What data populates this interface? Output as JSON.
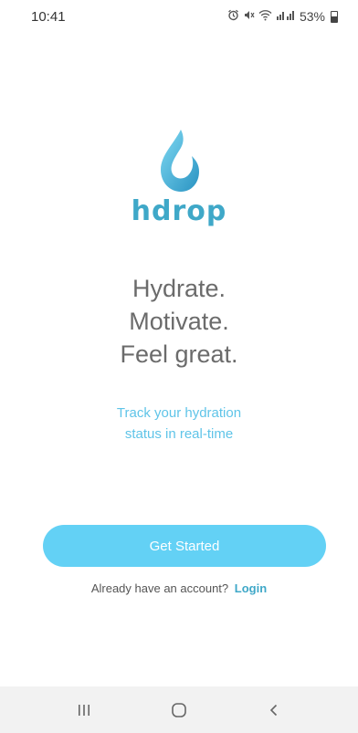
{
  "status_bar": {
    "time": "10:41",
    "battery_percent": "53%",
    "icons": [
      "alarm-icon",
      "mute-icon",
      "wifi-icon",
      "signal-icon",
      "battery-icon"
    ]
  },
  "brand": {
    "name": "hdrop",
    "colors": {
      "primary": "#3fa8c8",
      "accent": "#63d1f5",
      "text": "#6b6b6b"
    }
  },
  "headline": {
    "line1": "Hydrate.",
    "line2": "Motivate.",
    "line3": "Feel great."
  },
  "subtitle": {
    "line1": "Track your hydration",
    "line2": "status in real-time"
  },
  "cta": {
    "label": "Get Started"
  },
  "login": {
    "prompt": "Already have an account?",
    "link": "Login"
  },
  "nav_bar": {
    "buttons": [
      "recent-apps-icon",
      "home-icon",
      "back-icon"
    ]
  }
}
